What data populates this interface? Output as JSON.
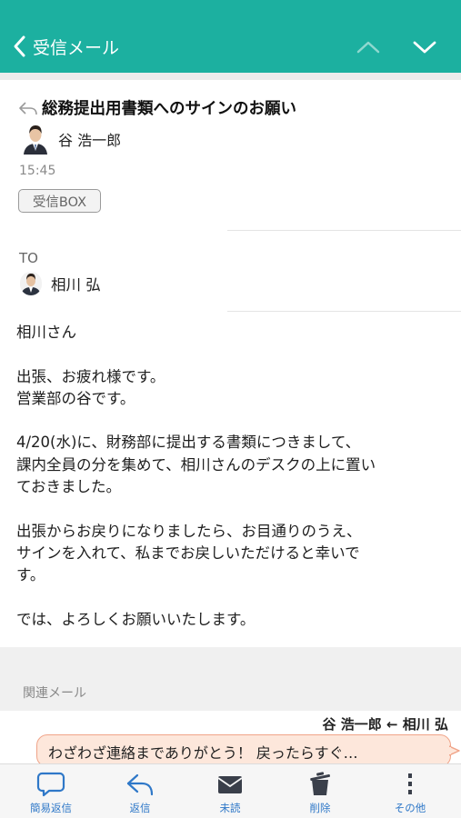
{
  "header": {
    "back_label": "受信メール",
    "color": "#1cb0a0"
  },
  "mail": {
    "subject": "総務提出用書類へのサインのお願い",
    "sender": "谷 浩一郎",
    "time": "15:45",
    "folder": "受信BOX",
    "to_label": "TO",
    "recipient": "相川 弘",
    "body": [
      [
        "相川さん"
      ],
      [
        "出張、お疲れ様です。",
        "営業部の谷です。"
      ],
      [
        "4/20(水)に、財務部に提出する書類につきまして、",
        "課内全員の分を集めて、相川さんのデスクの上に置い",
        "ておきました。"
      ],
      [
        "出張からお戻りになりましたら、お目通りのうえ、",
        "サインを入れて、私までお戻しいただけると幸いで",
        "す。"
      ],
      [
        "では、よろしくお願いいたします。"
      ]
    ]
  },
  "related": {
    "label": "関連メール",
    "thread_names": "谷 浩一郎 ← 相川 弘",
    "preview": "わざわざ連絡までありがとう！ 戻ったらすぐ…"
  },
  "toolbar": {
    "quick_reply": "簡易返信",
    "reply": "返信",
    "unread": "未読",
    "delete": "削除",
    "more": "その他",
    "accent": "#2f78c8"
  }
}
